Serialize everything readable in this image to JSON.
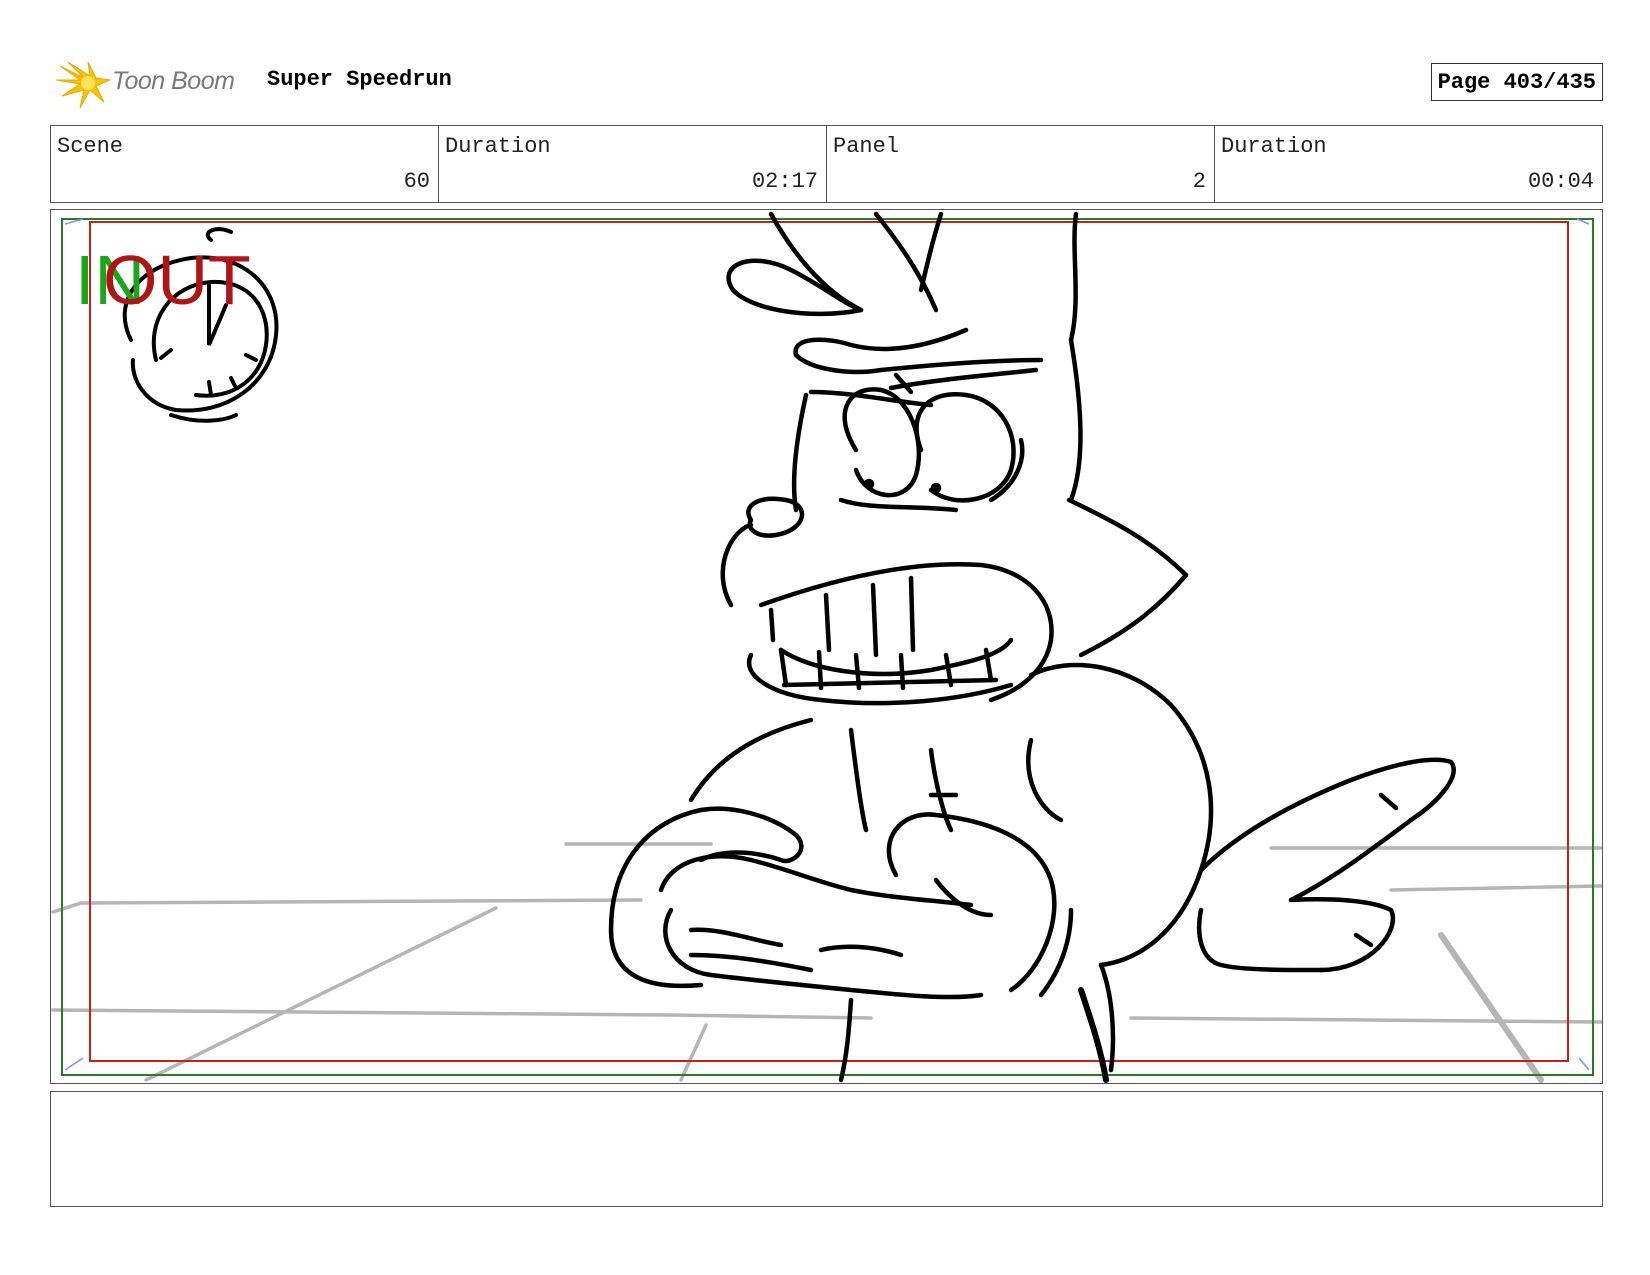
{
  "header": {
    "logo_text": "Toon Boom",
    "project_title": "Super Speedrun",
    "page_label": "Page 403/435"
  },
  "info": {
    "scene_label": "Scene",
    "scene_value": "60",
    "scene_duration_label": "Duration",
    "scene_duration_value": "02:17",
    "panel_label": "Panel",
    "panel_value": "2",
    "panel_duration_label": "Duration",
    "panel_duration_value": "00:04"
  },
  "frame": {
    "in_label": "IN",
    "out_label": "OUT",
    "in_color": "#1aa51a",
    "out_color": "#b01515",
    "safe_frame_color": "#2a7a2a",
    "action_frame_color": "#c81e1e"
  },
  "notes": {
    "text": ""
  }
}
